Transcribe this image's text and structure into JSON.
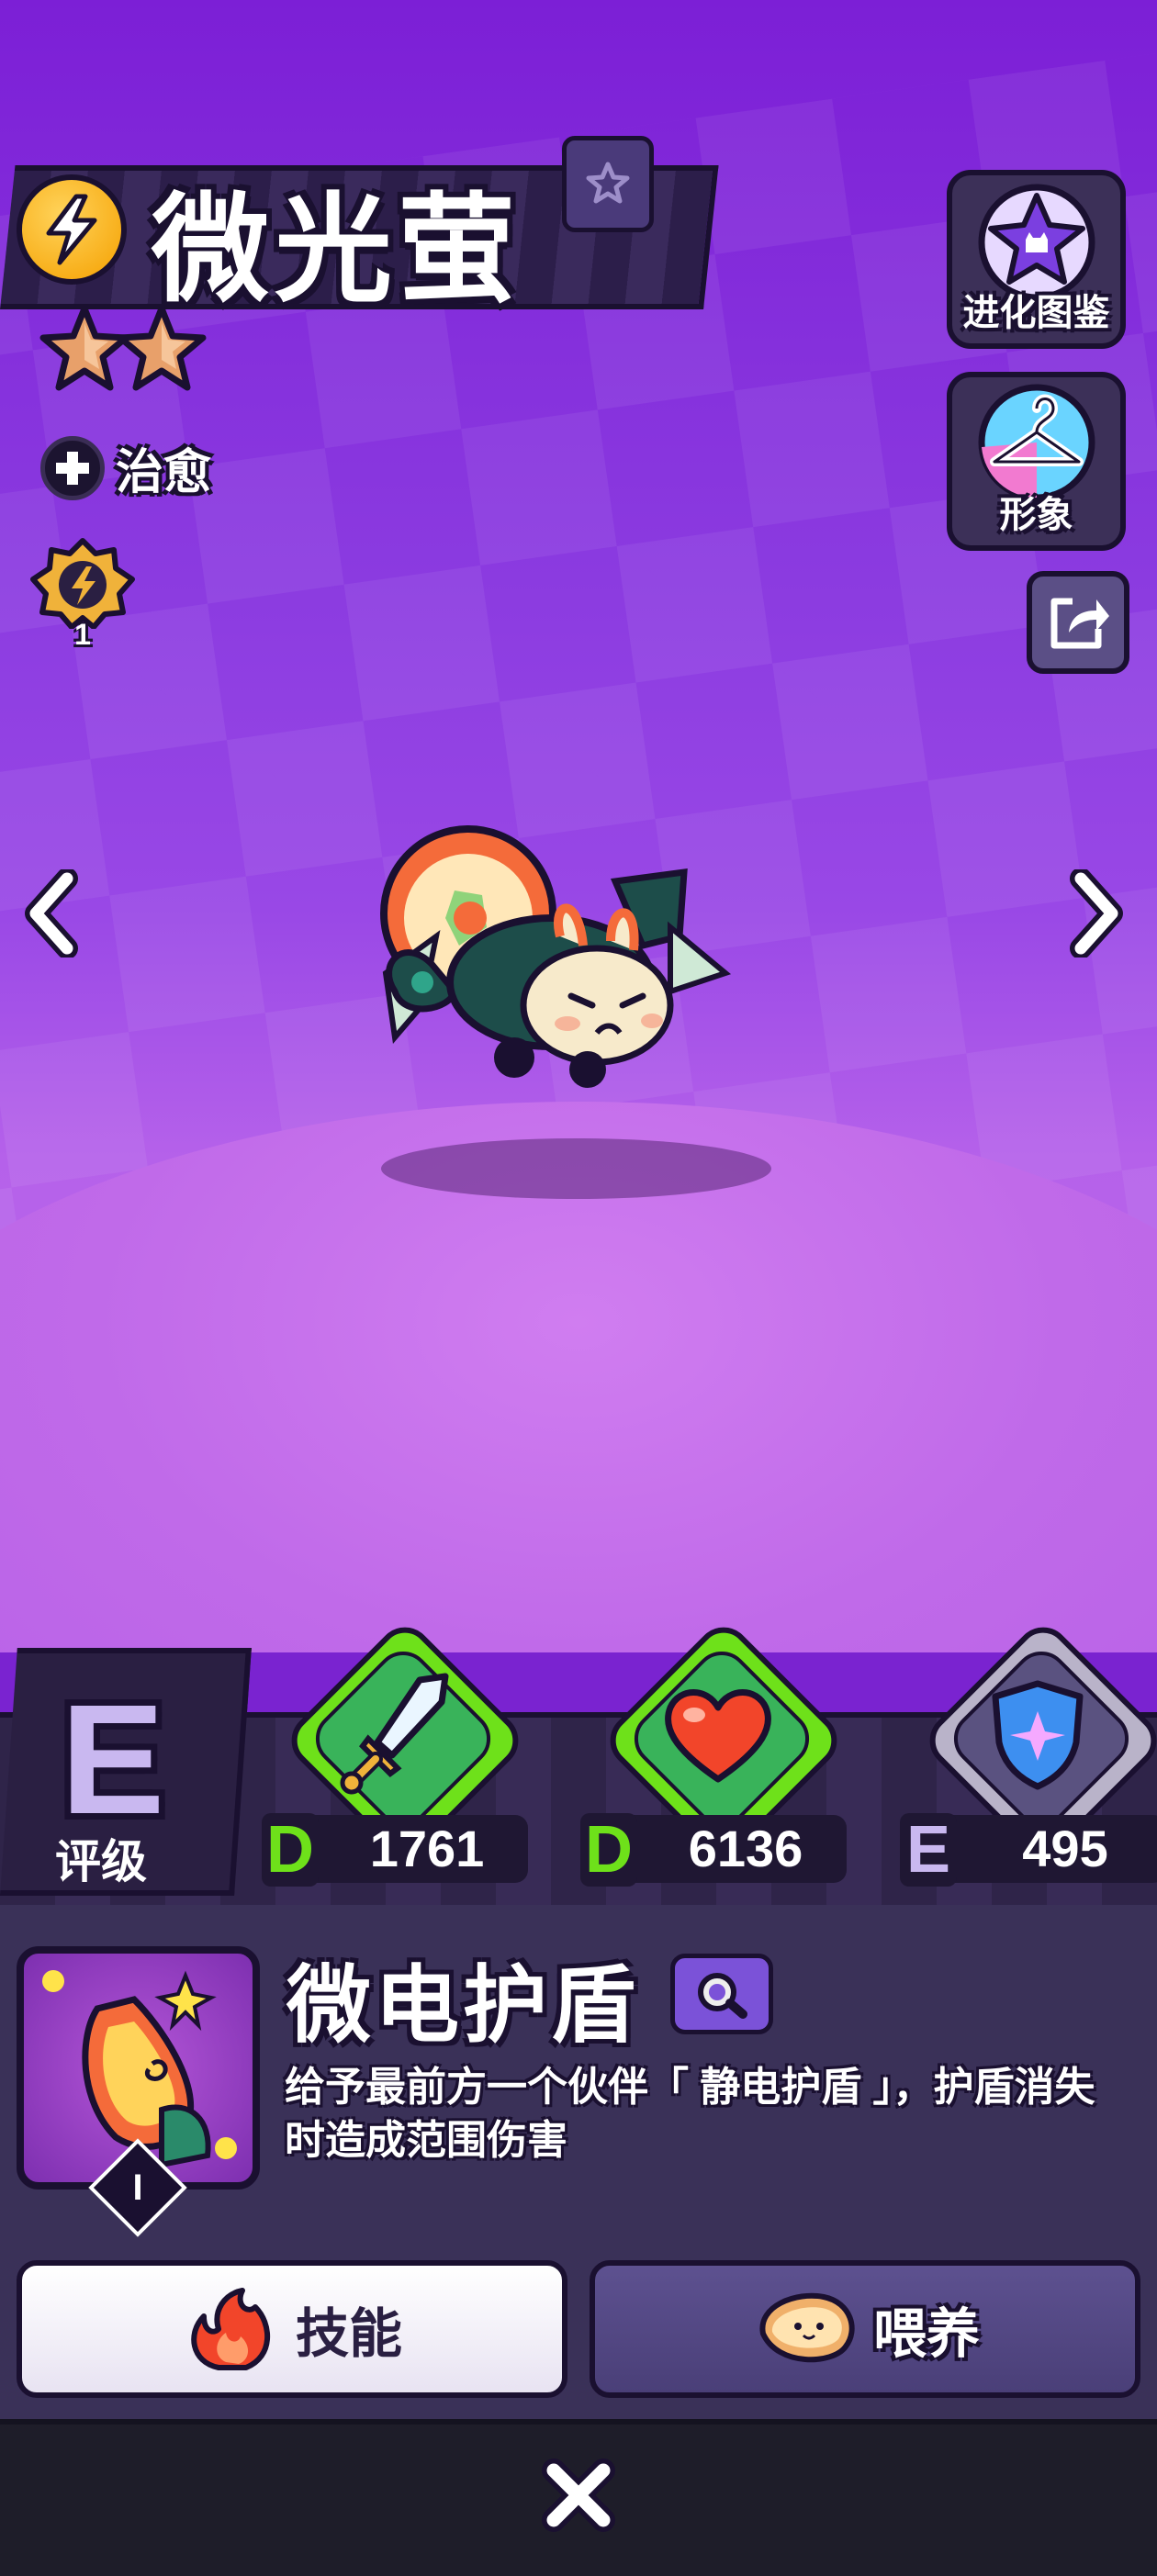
{
  "pet": {
    "name": "微光萤",
    "star_count": 2,
    "trait_label": "治愈",
    "level": "1"
  },
  "side_buttons": {
    "evolution_label": "进化图鉴",
    "appearance_label": "形象"
  },
  "grade": {
    "letter": "E",
    "label": "评级"
  },
  "stats": [
    {
      "name": "attack",
      "icon": "sword-icon",
      "grade": "D",
      "value": "1761",
      "grade_color": "#6ee11a"
    },
    {
      "name": "health",
      "icon": "heart-icon",
      "grade": "D",
      "value": "6136",
      "grade_color": "#6ee11a"
    },
    {
      "name": "defense",
      "icon": "shield-icon",
      "grade": "E",
      "value": "495",
      "grade_color": "#c9b8f0"
    }
  ],
  "skill": {
    "name": "微电护盾",
    "rank": "I",
    "description": "给予最前方一个伙伴「 静电护盾 」，护盾消失时造成范围伤害"
  },
  "tabs": {
    "skill_label": "技能",
    "feed_label": "喂养"
  },
  "colors": {
    "background_top": "#7c1fd6",
    "floor": "#c06ae9",
    "panel": "#3a3158",
    "outline": "#1a1030",
    "attack_ring": "#6ee11a",
    "defense_ring": "#b9b3c9"
  }
}
